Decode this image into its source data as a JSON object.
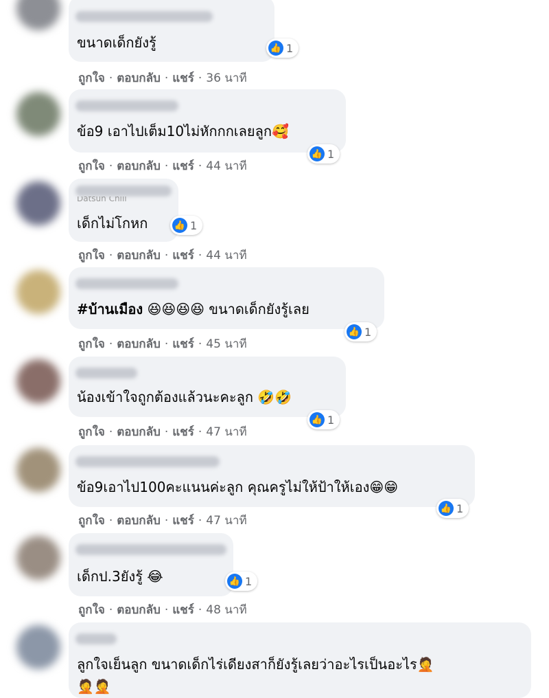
{
  "like_count": "1",
  "actions": {
    "like": "ถูกใจ",
    "reply": "ตอบกลับ",
    "share": "แชร์",
    "separator": "·"
  },
  "comments": [
    {
      "text": "ขนาดเด็กยังรู้",
      "time": "36 นาที"
    },
    {
      "text": "ข้อ9 เอาไปเต็ม10ไม่หักกกเลยลูก🥰",
      "time": "44 นาที"
    },
    {
      "name_fragment": "Datsun Chill",
      "text": "เด็กไม่โกหก",
      "time": "44 นาที"
    },
    {
      "hashtag": "#บ้านเมือง",
      "text": "😆😆😆😆 ขนาดเด็กยังรู้เลย",
      "time": "45 นาที"
    },
    {
      "text": "น้องเข้าใจถูกต้องแล้วนะคะลูก 🤣🤣",
      "time": "47 นาที"
    },
    {
      "text": "ข้อ9เอาไป100คะแนนค่ะลูก คุณครูไม่ให้ป้าให้เอง😁😁",
      "time": "47 นาที"
    },
    {
      "text": "เด็กป.3ยังรู้ 😂",
      "time": "48 นาที"
    },
    {
      "text": "ลูกใจเย็นลูก ขนาดเด็กไร่เดียงสาก็ยังรู้เลยว่าอะไรเป็นอะไร🤦",
      "text2": "🤦🤦"
    }
  ],
  "colors": {
    "bubble": "#f0f2f5",
    "like": "#1877f2",
    "meta": "#65676b"
  }
}
